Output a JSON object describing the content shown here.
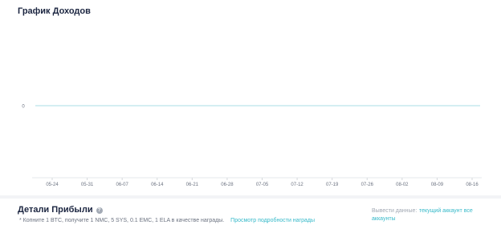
{
  "page": {
    "title": "График Доходов"
  },
  "chart_data": {
    "type": "line",
    "x": [
      "05-24",
      "05-31",
      "06-07",
      "06-14",
      "06-21",
      "06-28",
      "07-05",
      "07-12",
      "07-19",
      "07-26",
      "08-02",
      "08-09",
      "08-16"
    ],
    "series": [
      {
        "values": [
          0,
          0,
          0,
          0,
          0,
          0,
          0,
          0,
          0,
          0,
          0,
          0,
          0
        ]
      }
    ],
    "yticks": [
      "0"
    ],
    "title": "График Доходов",
    "xlabel": "",
    "ylabel": "",
    "line_color": "#a8dce4",
    "grid": false
  },
  "details": {
    "title": "Детали Прибыли",
    "help_icon": "?",
    "reward_text": "* Копните 1 BTC, получите 1 NMC, 5 SYS, 0.1 EMC, 1 ELA в качестве награды.",
    "reward_link": "Просмотр подробности награды",
    "export_label": "Вывести данные:",
    "export_link_current": "текущий аккаунт",
    "export_link_all": "все",
    "export_link_all_cont": "аккаунты"
  },
  "colors": {
    "accent": "#35b9c9",
    "line": "#a8dce4",
    "title": "#1b2540"
  }
}
